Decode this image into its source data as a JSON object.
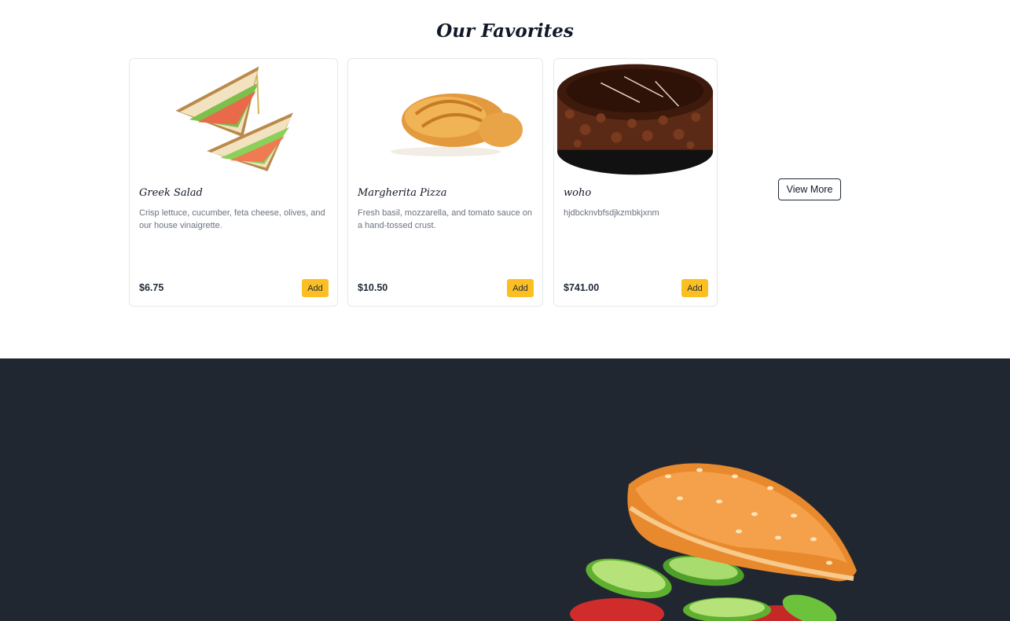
{
  "favorites": {
    "title": "Our Favorites",
    "view_more_label": "View More",
    "add_label": "Add",
    "items": [
      {
        "name": "Greek Salad",
        "description": "Crisp lettuce, cucumber, feta cheese, olives, and our house vinaigrette.",
        "price": "$6.75",
        "image": "sandwich-image"
      },
      {
        "name": "Margherita Pizza",
        "description": "Fresh basil, mozzarella, and tomato sauce on a hand-tossed crust.",
        "price": "$10.50",
        "image": "croissant-image"
      },
      {
        "name": "woho",
        "description": "hjdbcknvbfsdjkzmbkjxnm",
        "price": "$741.00",
        "image": "chocolate-cake-image"
      }
    ]
  },
  "hero": {
    "background_color": "#212731",
    "illustration": "burger-illustration"
  },
  "colors": {
    "accent": "#fbbf24",
    "dark": "#212731"
  }
}
